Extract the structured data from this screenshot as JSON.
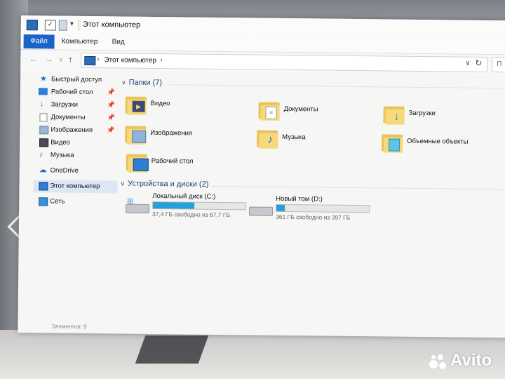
{
  "window": {
    "title": "Этот компьютер"
  },
  "ribbon": {
    "tabs": [
      "Файл",
      "Компьютер",
      "Вид"
    ]
  },
  "address": {
    "path": "Этот компьютер",
    "search_placeholder": "П"
  },
  "sidebar": {
    "items": [
      {
        "label": "Быстрый доступ",
        "icon": "star-icon"
      },
      {
        "label": "Рабочий стол",
        "icon": "desktop-icon",
        "pinned": true
      },
      {
        "label": "Загрузки",
        "icon": "download-icon",
        "pinned": true
      },
      {
        "label": "Документы",
        "icon": "documents-icon",
        "pinned": true
      },
      {
        "label": "Изображения",
        "icon": "pictures-icon",
        "pinned": true
      },
      {
        "label": "Видео",
        "icon": "video-icon"
      },
      {
        "label": "Музыка",
        "icon": "music-icon"
      },
      {
        "label": "OneDrive",
        "icon": "cloud-icon"
      },
      {
        "label": "Этот компьютер",
        "icon": "computer-icon",
        "selected": true
      },
      {
        "label": "Сеть",
        "icon": "network-icon"
      }
    ]
  },
  "folders": {
    "header": "Папки (7)",
    "items": [
      {
        "label": "Видео",
        "icon": "video-folder-icon"
      },
      {
        "label": "Документы",
        "icon": "documents-folder-icon"
      },
      {
        "label": "Загрузки",
        "icon": "downloads-folder-icon"
      },
      {
        "label": "Изображения",
        "icon": "pictures-folder-icon"
      },
      {
        "label": "Музыка",
        "icon": "music-folder-icon"
      },
      {
        "label": "Объемные объекты",
        "icon": "3d-objects-folder-icon"
      },
      {
        "label": "Рабочий стол",
        "icon": "desktop-folder-icon"
      }
    ]
  },
  "drives": {
    "header": "Устройства и диски (2)",
    "items": [
      {
        "name": "Локальный диск (C:)",
        "free": "37,4 ГБ свободно из 67,7 ГБ",
        "used_fraction": 0.45
      },
      {
        "name": "Новый том (D:)",
        "free": "361 ГБ свободно из 397 ГБ",
        "used_fraction": 0.09
      }
    ]
  },
  "status": {
    "text": "Элементов: 9"
  },
  "watermark": {
    "text": "Avito"
  },
  "colors": {
    "accent": "#1a63c9",
    "drive_fill": "#26a0da",
    "group_header": "#1e3e7a",
    "selection": "#dbe7f5"
  }
}
